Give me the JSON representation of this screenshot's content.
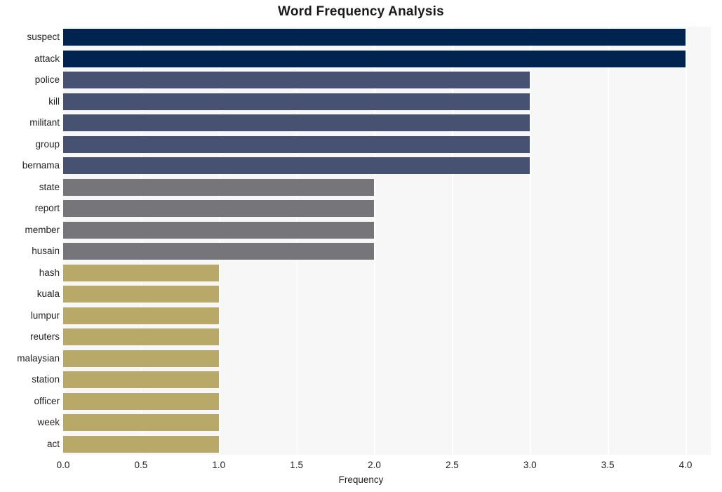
{
  "chart_data": {
    "type": "bar",
    "orientation": "horizontal",
    "title": "Word Frequency Analysis",
    "xlabel": "Frequency",
    "ylabel": "",
    "categories": [
      "suspect",
      "attack",
      "police",
      "kill",
      "militant",
      "group",
      "bernama",
      "state",
      "report",
      "member",
      "husain",
      "hash",
      "kuala",
      "lumpur",
      "reuters",
      "malaysian",
      "station",
      "officer",
      "week",
      "act"
    ],
    "values": [
      4,
      4,
      3,
      3,
      3,
      3,
      3,
      2,
      2,
      2,
      2,
      1,
      1,
      1,
      1,
      1,
      1,
      1,
      1,
      1
    ],
    "bar_colors": [
      "#00244f",
      "#00244f",
      "#475272",
      "#475272",
      "#475272",
      "#475272",
      "#475272",
      "#76767a",
      "#76767a",
      "#76767a",
      "#76767a",
      "#b8a969",
      "#b8a969",
      "#b8a969",
      "#b8a969",
      "#b8a969",
      "#b8a969",
      "#b8a969",
      "#b8a969",
      "#b8a969"
    ],
    "xlim": [
      0.0,
      4.1625
    ],
    "xticks": [
      0.0,
      0.5,
      1.0,
      1.5,
      2.0,
      2.5,
      3.0,
      3.5,
      4.0
    ],
    "xtick_labels": [
      "0.0",
      "0.5",
      "1.0",
      "1.5",
      "2.0",
      "2.5",
      "3.0",
      "3.5",
      "4.0"
    ],
    "grid": true,
    "grid_axis": "x",
    "grid_color": "#ffffff",
    "legend": false,
    "plot_background": "#f7f7f7",
    "figure_background": "#ffffff"
  }
}
